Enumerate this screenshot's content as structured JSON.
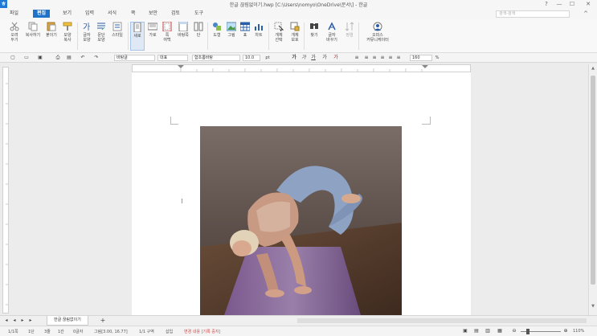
{
  "window": {
    "title": "한글 끊림없이기.hwp [C:\\Users\\nomyo\\OneDrive\\문서\\] - 한글",
    "minimize": "—",
    "maximize": "☐",
    "close": "✕",
    "help": "?",
    "ribbon_toggle": "^"
  },
  "menu": {
    "items": [
      "파일",
      "편집",
      "보기",
      "입력",
      "서식",
      "쪽",
      "보안",
      "검토",
      "도구"
    ],
    "active_index": 1,
    "search_placeholder": "검색-검색"
  },
  "ribbon": {
    "buttons": [
      {
        "label": "오려\n두기",
        "icon": "scissors-icon"
      },
      {
        "label": "복사하기",
        "icon": "copy-icon"
      },
      {
        "label": "붙이기",
        "icon": "paste-icon"
      },
      {
        "label": "모양\n복사",
        "icon": "format-painter-icon"
      },
      {
        "label": "글자\n모양",
        "icon": "char-shape-icon"
      },
      {
        "label": "문단\n모양",
        "icon": "para-shape-icon"
      },
      {
        "label": "스타일",
        "icon": "style-icon"
      },
      {
        "label": "세로",
        "icon": "vertical-page-icon"
      },
      {
        "label": "가로",
        "icon": "horizontal-page-icon"
      },
      {
        "label": "쪽\n여백",
        "icon": "page-margin-icon"
      },
      {
        "label": "바탕쪽",
        "icon": "master-page-icon"
      },
      {
        "label": "단",
        "icon": "column-icon"
      },
      {
        "label": "도형",
        "icon": "shape-icon"
      },
      {
        "label": "그림",
        "icon": "picture-icon"
      },
      {
        "label": "표",
        "icon": "table-icon"
      },
      {
        "label": "차트",
        "icon": "chart-icon"
      },
      {
        "label": "개체\n선택",
        "icon": "select-object-icon"
      },
      {
        "label": "개체\n보호",
        "icon": "protect-object-icon"
      },
      {
        "label": "찾기",
        "icon": "find-icon"
      },
      {
        "label": "글자\n바꾸기",
        "icon": "replace-icon"
      },
      {
        "label": "정렬",
        "icon": "sort-icon"
      },
      {
        "label": "오피스\n커뮤니케이터",
        "icon": "communicator-icon"
      }
    ]
  },
  "format": {
    "style": "바탕글",
    "lang": "대표",
    "font": "함초롬바탕",
    "size": "10.0",
    "unit": "pt",
    "zoom_ratio": "160",
    "percent": "%"
  },
  "document": {
    "image_alt": "요가 자세 사진"
  },
  "tabs": {
    "doc_tab": "한글 끊림없이기",
    "add": "+"
  },
  "status": {
    "page": "1/1쪽",
    "section": "1단",
    "line": "3줄",
    "col": "1칸",
    "chars": "0글자",
    "object": "그림[3.00, 16.77]",
    "area": "1/1 구역",
    "mode": "삽입",
    "change": "변경 내용 [기록 중지]",
    "zoom": "110%"
  },
  "colors": {
    "accent": "#1e73c8",
    "change_text": "#d04a4a"
  }
}
